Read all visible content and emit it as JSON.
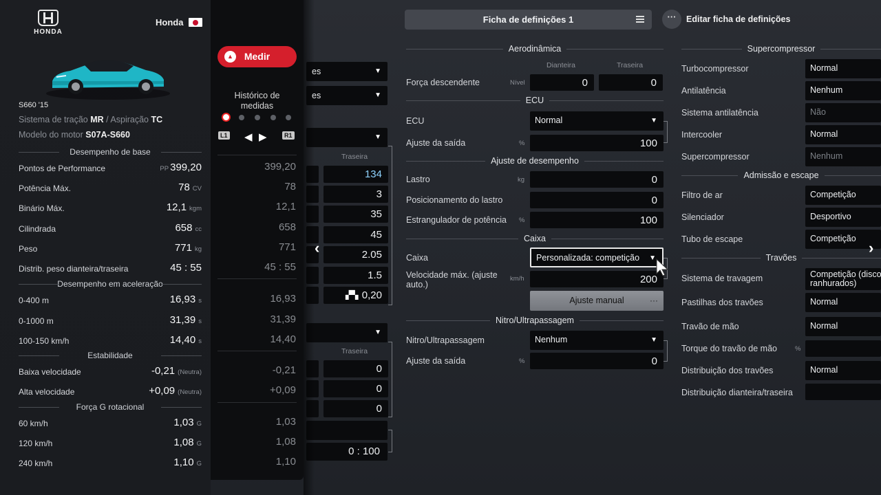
{
  "brand": {
    "logo_text": "HONDA",
    "name": "Honda"
  },
  "car": {
    "model": "S660 '15",
    "drivetrain_label": "Sistema de tração",
    "drivetrain": "MR",
    "aspiration_label": "Aspiração",
    "aspiration": "TC",
    "engine_label": "Modelo do motor",
    "engine": "S07A-S660"
  },
  "base_perf": {
    "title": "Desempenho de base",
    "rows": [
      {
        "label": "Pontos de Performance",
        "prefix": "PP",
        "value": "399,20",
        "unit": "",
        "hist": "399,20"
      },
      {
        "label": "Potência Máx.",
        "prefix": "",
        "value": "78",
        "unit": "CV",
        "hist": "78"
      },
      {
        "label": "Binário Máx.",
        "prefix": "",
        "value": "12,1",
        "unit": "kgm",
        "hist": "12,1"
      },
      {
        "label": "Cilindrada",
        "prefix": "",
        "value": "658",
        "unit": "cc",
        "hist": "658"
      },
      {
        "label": "Peso",
        "prefix": "",
        "value": "771",
        "unit": "kg",
        "hist": "771"
      },
      {
        "label": "Distrib. peso dianteira/traseira",
        "prefix": "",
        "value": "45 : 55",
        "unit": "",
        "hist": "45 : 55"
      }
    ]
  },
  "accel_perf": {
    "title": "Desempenho em aceleração",
    "rows": [
      {
        "label": "0-400 m",
        "value": "16,93",
        "unit": "s",
        "hist": "16,93"
      },
      {
        "label": "0-1000 m",
        "value": "31,39",
        "unit": "s",
        "hist": "31,39"
      },
      {
        "label": "100-150 km/h",
        "value": "14,40",
        "unit": "s",
        "hist": "14,40"
      }
    ]
  },
  "stability": {
    "title": "Estabilidade",
    "rows": [
      {
        "label": "Baixa velocidade",
        "value": "-0,21",
        "unit": "(Neutra)",
        "hist": "-0,21"
      },
      {
        "label": "Alta velocidade",
        "value": "+0,09",
        "unit": "(Neutra)",
        "hist": "+0,09"
      }
    ]
  },
  "gforce": {
    "title": "Força G rotacional",
    "rows": [
      {
        "label": "60 km/h",
        "value": "1,03",
        "unit": "G",
        "hist": "1,03"
      },
      {
        "label": "120 km/h",
        "value": "1,08",
        "unit": "G",
        "hist": "1,08"
      },
      {
        "label": "240 km/h",
        "value": "1,10",
        "unit": "G",
        "hist": "1,10"
      }
    ]
  },
  "measure": {
    "button": "Medir",
    "history_line1": "Histórico de",
    "history_line2": "medidas",
    "l1": "L1",
    "r1": "R1"
  },
  "hidden_panel": {
    "dd1_suffix": "es",
    "dd2_suffix": "es",
    "col_rear": "Traseira",
    "vals": [
      "134",
      "3",
      "35",
      "45",
      "2.05",
      "1.5",
      "0,20"
    ],
    "col_rear2": "Traseira",
    "vals2": [
      "0",
      "0",
      "0"
    ],
    "ratio": "0 : 100"
  },
  "topbar": {
    "sheet": "Ficha de definições 1",
    "edit": "Editar ficha de definições"
  },
  "aero": {
    "title": "Aerodinâmica",
    "col_front": "Dianteira",
    "col_rear": "Traseira",
    "downforce": "Força descendente",
    "level": "Nível",
    "front": "0",
    "rear": "0"
  },
  "ecu": {
    "title": "ECU",
    "label": "ECU",
    "value": "Normal",
    "output": "Ajuste da saída",
    "output_unit": "%",
    "output_value": "100"
  },
  "perf_adj": {
    "title": "Ajuste de desempenho",
    "ballast": "Lastro",
    "ballast_unit": "kg",
    "ballast_value": "0",
    "ballast_pos": "Posicionamento do lastro",
    "ballast_pos_value": "0",
    "restrictor": "Estrangulador de potência",
    "restrictor_unit": "%",
    "restrictor_value": "100"
  },
  "gearbox": {
    "title": "Caixa",
    "label": "Caixa",
    "value": "Personalizada: competição",
    "top_speed": "Velocidade máx. (ajuste auto.)",
    "top_speed_unit": "km/h",
    "top_speed_value": "200",
    "manual": "Ajuste manual"
  },
  "nitro": {
    "title": "Nitro/Ultrapassagem",
    "label": "Nitro/Ultrapassagem",
    "value": "Nenhum",
    "output": "Ajuste da saída",
    "output_unit": "%",
    "output_value": "0"
  },
  "supercharger": {
    "title": "Supercompressor",
    "rows": [
      {
        "label": "Turbocompressor",
        "value": "Normal"
      },
      {
        "label": "Antilatência",
        "value": "Nenhum"
      },
      {
        "label": "Sistema antilatência",
        "value": "Não"
      },
      {
        "label": "Intercooler",
        "value": "Normal"
      },
      {
        "label": "Supercompressor",
        "value": "Nenhum"
      }
    ]
  },
  "intake": {
    "title": "Admissão e escape",
    "rows": [
      {
        "label": "Filtro de ar",
        "value": "Competição"
      },
      {
        "label": "Silenciador",
        "value": "Desportivo"
      },
      {
        "label": "Tubo de escape",
        "value": "Competição"
      }
    ]
  },
  "brakes": {
    "title": "Travões",
    "system": "Sistema de travagem",
    "system_value_1": "Competição (disco",
    "system_value_2": "ranhurados)",
    "pads": "Pastilhas dos travões",
    "pads_value": "Normal",
    "handbrake": "Travão de mão",
    "handbrake_value": "Normal",
    "handbrake_torque": "Torque do travão de mão",
    "handbrake_torque_unit": "%",
    "balance": "Distribuição dos travões",
    "balance_value": "Normal",
    "fr_balance": "Distribuição dianteira/traseira"
  }
}
